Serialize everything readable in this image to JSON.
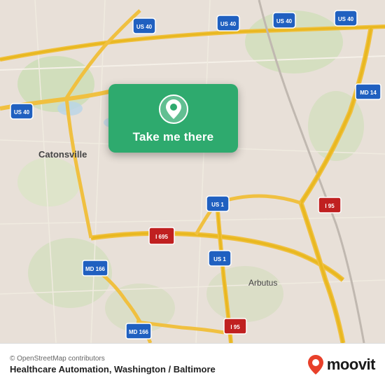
{
  "map": {
    "background_color": "#e8e0d8",
    "center_lat": 39.25,
    "center_lng": -76.67
  },
  "card": {
    "label": "Take me there",
    "pin_icon": "location-pin",
    "bg_color": "#2eaa6e"
  },
  "bottom_bar": {
    "copyright": "© OpenStreetMap contributors",
    "location_name": "Healthcare Automation, Washington / Baltimore",
    "logo_text": "moovit"
  },
  "map_labels": {
    "catonsville": "Catonsville",
    "arbutus": "Arbutus",
    "us40_label": "US 40",
    "us1_label": "US 1",
    "i695_label": "I 695",
    "i95_label": "I 95",
    "md166_label": "MD 166",
    "md14_label": "MD 14"
  }
}
